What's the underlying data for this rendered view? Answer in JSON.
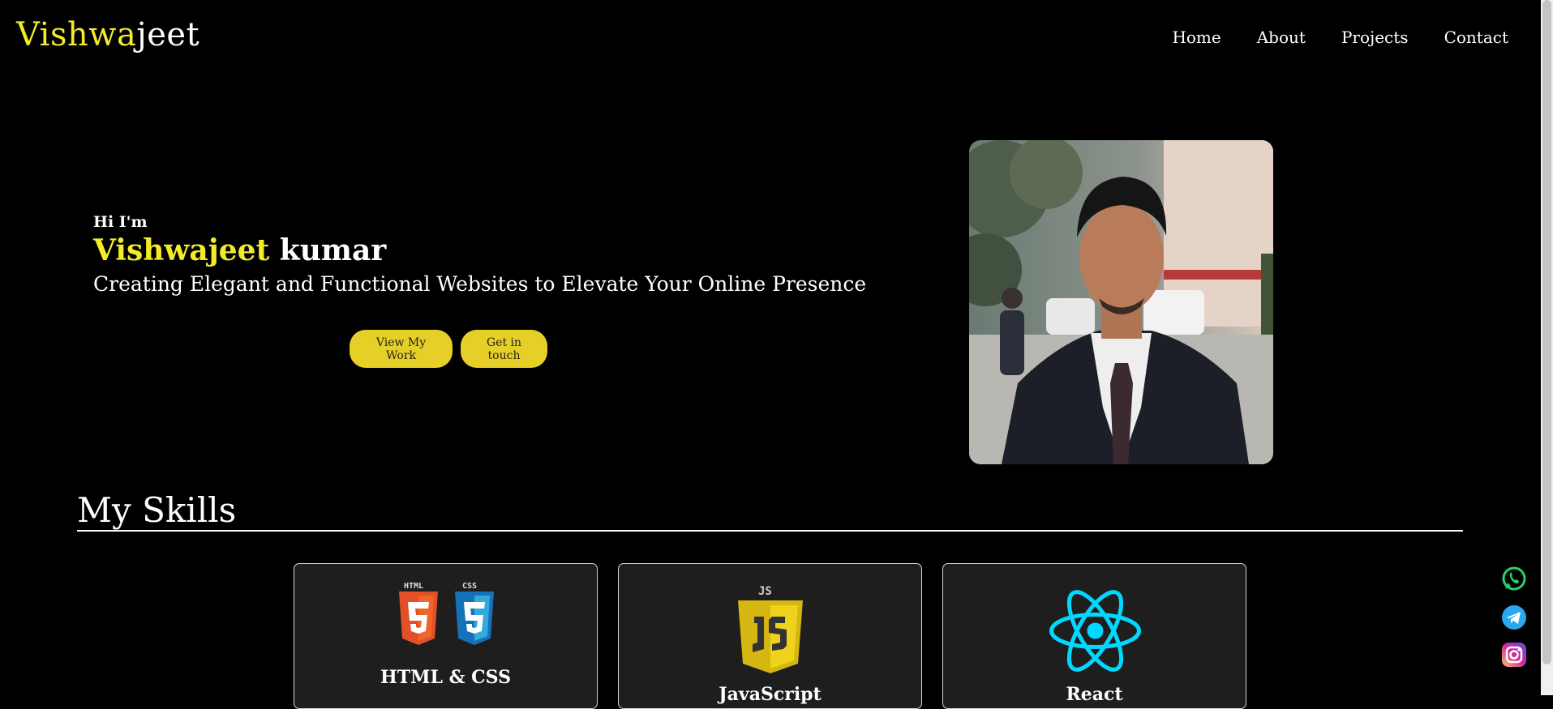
{
  "header": {
    "logo_accent": "Vishwa",
    "logo_rest": "jeet",
    "nav": [
      {
        "label": "Home"
      },
      {
        "label": "About"
      },
      {
        "label": "Projects"
      },
      {
        "label": "Contact"
      }
    ]
  },
  "hero": {
    "greeting": "Hi I'm",
    "name_first": "Vishwajeet",
    "name_last": "kumar",
    "tagline": "Creating Elegant and Functional Websites to Elevate Your Online Presence",
    "buttons": {
      "work": "View My Work",
      "contact": "Get in touch"
    }
  },
  "skills": {
    "title": "My Skills",
    "cards": [
      {
        "name": "HTML & CSS",
        "icon": "html-css-icon",
        "badge1": "HTML",
        "badge2": "CSS"
      },
      {
        "name": "JavaScript",
        "icon": "js-icon",
        "badge": "JS"
      },
      {
        "name": "React",
        "icon": "react-icon"
      }
    ]
  },
  "social": [
    {
      "icon": "whatsapp-icon",
      "color": "#25d366"
    },
    {
      "icon": "telegram-icon",
      "color": "#29a9eb"
    },
    {
      "icon": "instagram-icon",
      "color": "#d6249f"
    }
  ],
  "colors": {
    "accent": "#f2ec28",
    "button_bg": "#e6cf27",
    "background": "#000000",
    "card_bg": "#1e1e1e"
  }
}
